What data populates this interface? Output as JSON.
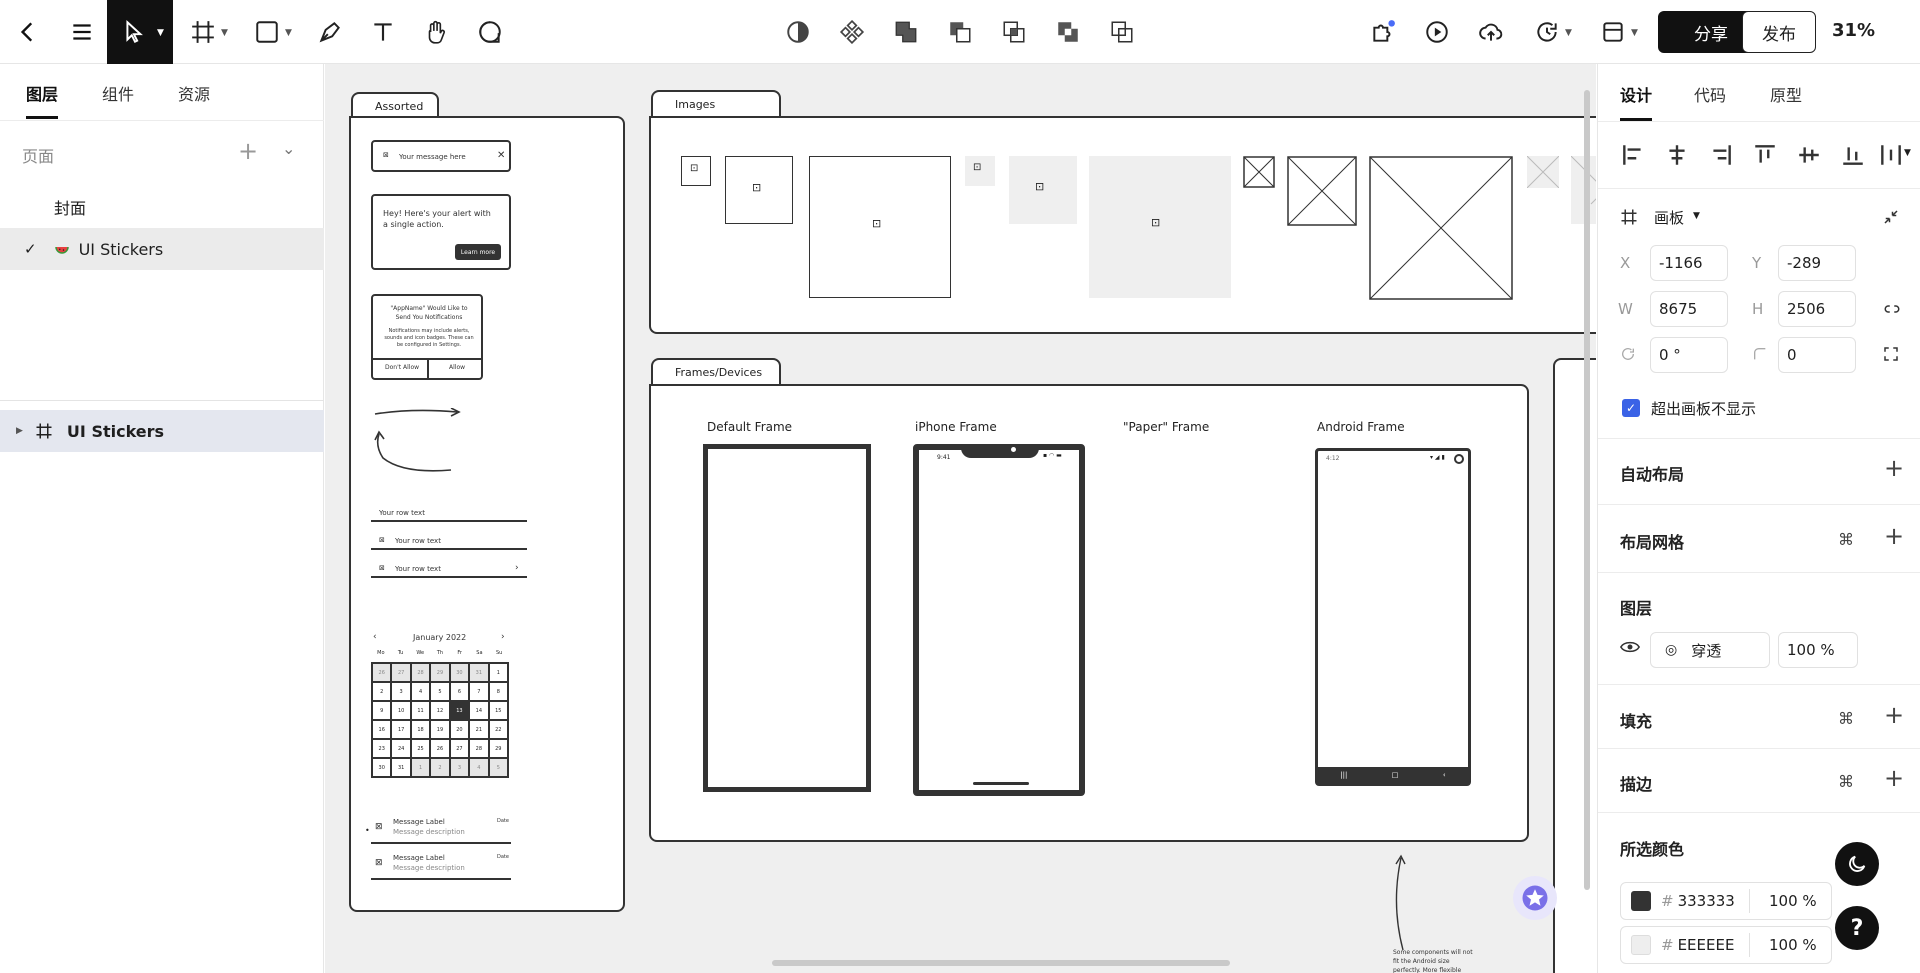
{
  "toolbar": {
    "share_label": "分享",
    "publish_label": "发布",
    "zoom": "31%"
  },
  "left_panel": {
    "tabs": [
      "图层",
      "组件",
      "资源"
    ],
    "pages_title": "页面",
    "pages": [
      {
        "label": "封面",
        "active": false
      },
      {
        "label": "UI Stickers",
        "active": true
      }
    ],
    "layer": "UI Stickers"
  },
  "canvas": {
    "folders": {
      "assorted": "Assorted",
      "images": "Images",
      "frames": "Frames/Devices"
    },
    "assorted": {
      "message": "Your message here",
      "alert_text": "Hey! Here's your alert with a single action.",
      "learn_more": "Learn more",
      "dialog_title": "\"AppName\" Would Like to Send You Notifications",
      "dialog_body": "Notifications may include alerts, sounds and icon badges. These can be configured in Settings.",
      "dont_allow": "Don't Allow",
      "allow": "Allow",
      "row_text": "Your row text",
      "calendar_month": "January 2022",
      "calendar_days": [
        "Mo",
        "Tu",
        "We",
        "Th",
        "Fr",
        "Sa",
        "Su"
      ],
      "calendar_dates": [
        "26",
        "27",
        "28",
        "29",
        "30",
        "31",
        "1",
        "2",
        "3",
        "4",
        "5",
        "6",
        "7",
        "8",
        "9",
        "10",
        "11",
        "12",
        "13",
        "14",
        "15",
        "16",
        "17",
        "18",
        "19",
        "20",
        "21",
        "22",
        "23",
        "24",
        "25",
        "26",
        "27",
        "28",
        "29",
        "30",
        "31",
        "1",
        "2",
        "3",
        "4",
        "5"
      ],
      "message_label": "Message Label",
      "message_desc": "Message description",
      "date": "Date"
    },
    "frames": {
      "default": "Default Frame",
      "iphone": "iPhone Frame",
      "paper": "\"Paper\" Frame",
      "android": "Android Frame",
      "iphone_time": "9:41",
      "android_time": "4:12",
      "note": "Some components will not fit the Android size perfectly. More flexible components coming soon!"
    }
  },
  "right_panel": {
    "tabs": [
      "设计",
      "代码",
      "原型"
    ],
    "frame_type": "画板",
    "x": "-1166",
    "y": "-289",
    "w": "8675",
    "h": "2506",
    "rotation": "0 °",
    "radius": "0",
    "clip_label": "超出画板不显示",
    "auto_layout": "自动布局",
    "layout_grid": "布局网格",
    "layer_title": "图层",
    "blend_mode": "穿透",
    "opacity": "100 %",
    "fill": "填充",
    "stroke": "描边",
    "selected_colors": "所选颜色",
    "colors": [
      {
        "hex": "333333",
        "opacity": "100 %",
        "swatch": "#333333"
      },
      {
        "hex": "EEEEEE",
        "opacity": "100 %",
        "swatch": "#EEEEEE"
      }
    ],
    "help": "?"
  }
}
